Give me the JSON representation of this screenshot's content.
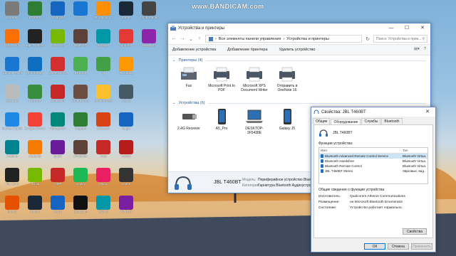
{
  "watermark": "www.BANDICAM.com",
  "desktop_icons": [
    {
      "label": "Корзина",
      "color": "#7a7a7a",
      "col": 0,
      "row": 0
    },
    {
      "label": "µTorrent",
      "color": "#2e7d32",
      "col": 1,
      "row": 0
    },
    {
      "label": "Advanced",
      "color": "#1565c0",
      "col": 2,
      "row": 0
    },
    {
      "label": "PC",
      "color": "#1976d2",
      "col": 3,
      "row": 0
    },
    {
      "label": "FL Studio 20",
      "color": "#ff8f00",
      "col": 4,
      "row": 0
    },
    {
      "label": "Steam",
      "color": "#1b2838",
      "col": 5,
      "row": 0
    },
    {
      "label": "Tomb Raider",
      "color": "#444",
      "col": 6,
      "row": 0
    },
    {
      "label": "Euro Truck",
      "color": "#ff6f00",
      "col": 0,
      "row": 1
    },
    {
      "label": "Epic Games",
      "color": "#222",
      "col": 1,
      "row": 1
    },
    {
      "label": "GeForce",
      "color": "#76b900",
      "col": 2,
      "row": 1
    },
    {
      "label": "Minecraft",
      "color": "#5d4037",
      "col": 3,
      "row": 1
    },
    {
      "label": "Tunngle",
      "color": "#0097a7",
      "col": 4,
      "row": 1
    },
    {
      "label": "Chrome",
      "color": "#e53935",
      "col": 5,
      "row": 1
    },
    {
      "label": "Wallpaper",
      "color": "#8e24aa",
      "col": 6,
      "row": 1
    },
    {
      "label": "Control Panel",
      "color": "#1976d2",
      "col": 0,
      "row": 2
    },
    {
      "label": "TeamViewer",
      "color": "#0e6ebf",
      "col": 1,
      "row": 2
    },
    {
      "label": "Sweet Home",
      "color": "#d32f2f",
      "col": 2,
      "row": 2
    },
    {
      "label": "uTorrent",
      "color": "#4caf50",
      "col": 3,
      "row": 2
    },
    {
      "label": "TI",
      "color": "#43a047",
      "col": 4,
      "row": 2
    },
    {
      "label": "FL Studio",
      "color": "#ff9800",
      "col": 5,
      "row": 2
    },
    {
      "label": "Корзина",
      "color": "#bbb",
      "col": 0,
      "row": 3
    },
    {
      "label": "µTorrent",
      "color": "#388e3c",
      "col": 1,
      "row": 3
    },
    {
      "label": "Bandicam",
      "color": "#c62828",
      "col": 2,
      "row": 3
    },
    {
      "label": "SmartShare",
      "color": "#6d4c41",
      "col": 3,
      "row": 3
    },
    {
      "label": "My Bittorrent",
      "color": "#fbc02d",
      "col": 4,
      "row": 3
    },
    {
      "label": "ASUS",
      "color": "#455a64",
      "col": 5,
      "row": 3
    },
    {
      "label": "Internet Explorer",
      "color": "#1e88e5",
      "col": 0,
      "row": 4
    },
    {
      "label": "Google Chrome",
      "color": "#f44336",
      "col": 1,
      "row": 4
    },
    {
      "label": "Настройки",
      "color": "#00897b",
      "col": 2,
      "row": 4
    },
    {
      "label": "Торрент",
      "color": "#2e7d32",
      "col": 3,
      "row": 4
    },
    {
      "label": "Ccleaner",
      "color": "#d84315",
      "col": 4,
      "row": 4
    },
    {
      "label": "Magic",
      "color": "#1565c0",
      "col": 5,
      "row": 4
    },
    {
      "label": "Arduino",
      "color": "#00838f",
      "col": 0,
      "row": 5
    },
    {
      "label": "Audacity",
      "color": "#f57c00",
      "col": 1,
      "row": 5
    },
    {
      "label": "Quick",
      "color": "#6a1b9a",
      "col": 2,
      "row": 5
    },
    {
      "label": "Simulator",
      "color": "#5d4037",
      "col": 3,
      "row": 5
    },
    {
      "label": "Total",
      "color": "#c62828",
      "col": 4,
      "row": 5
    },
    {
      "label": "Adobe",
      "color": "#b71c1c",
      "col": 5,
      "row": 5
    },
    {
      "label": "The Sims",
      "color": "#222",
      "col": 0,
      "row": 6
    },
    {
      "label": "Nvidia",
      "color": "#76b900",
      "col": 1,
      "row": 6
    },
    {
      "label": "AIMP",
      "color": "#c62828",
      "col": 2,
      "row": 6
    },
    {
      "label": "Spotify",
      "color": "#1db954",
      "col": 3,
      "row": 6
    },
    {
      "label": "Music",
      "color": "#e91e63",
      "col": 4,
      "row": 6
    },
    {
      "label": "Game",
      "color": "#333",
      "col": 5,
      "row": 6
    },
    {
      "label": "Firefox",
      "color": "#e65100",
      "col": 0,
      "row": 7
    },
    {
      "label": "Steam",
      "color": "#1b2838",
      "col": 1,
      "row": 7
    },
    {
      "label": "Word",
      "color": "#1565c0",
      "col": 2,
      "row": 7
    },
    {
      "label": "Bandicam",
      "color": "#111",
      "col": 3,
      "row": 7
    },
    {
      "label": "Switch",
      "color": "#0097a7",
      "col": 4,
      "row": 7
    },
    {
      "label": "WinRAR",
      "color": "#7b1fa2",
      "col": 5,
      "row": 7
    }
  ],
  "explorer": {
    "title": "Устройства и принтеры",
    "min": "—",
    "max": "☐",
    "close": "✕",
    "breadcrumb_1": "Все элементы панели управления",
    "breadcrumb_2": "Устройства и принтеры",
    "search_placeholder": "Поиск: Устройства и прин...",
    "cmd_add_device": "Добавление устройства",
    "cmd_add_printer": "Добавление принтера",
    "cmd_remove": "Удалить устройство",
    "printers_header": "Принтеры (4)",
    "printers": [
      {
        "label": "Fax",
        "kind": "fax"
      },
      {
        "label": "Microsoft Print to PDF",
        "kind": "printer"
      },
      {
        "label": "Microsoft XPS Document Writer",
        "kind": "printer"
      },
      {
        "label": "Отправить в OneNote 16",
        "kind": "printer"
      }
    ],
    "devices_header": "Устройства (6)",
    "devices": [
      {
        "label": "2.4G Receiver",
        "kind": "receiver"
      },
      {
        "label": "A5_Pro",
        "kind": "phone"
      },
      {
        "label": "DESKTOP-3F5438E",
        "kind": "laptop"
      },
      {
        "label": "Galaxy J5",
        "kind": "phone"
      },
      {
        "label": "",
        "kind": "phone"
      }
    ],
    "details": {
      "name": "JBL T460BT",
      "model_key": "Модель:",
      "model_val": "Периферийное устройство Bluetooth",
      "cat_key": "Категория:",
      "cat_val": "Гарнитура Bluetooth Аудиоустройство"
    }
  },
  "dialog": {
    "title": "Свойства: JBL T460BT",
    "close": "✕",
    "tabs": [
      "Общие",
      "Оборудование",
      "Службы",
      "Bluetooth"
    ],
    "active_tab": 1,
    "device_name": "JBL T460BT",
    "functions_label": "Функции устройства:",
    "col_name": "Имя",
    "col_type": "Тип",
    "functions": [
      {
        "name": "Bluetooth Advanced Remote Control Service",
        "type": "Bluetooth Virtua...",
        "selected": true
      },
      {
        "name": "Bluetooth Handsfree",
        "type": "Bluetooth Virtua...",
        "selected": false
      },
      {
        "name": "Bluetooth Remote Control",
        "type": "Bluetooth Virtua...",
        "selected": false
      },
      {
        "name": "JBL T460BT Stereo",
        "type": "Звуковые, вид...",
        "selected": false
      }
    ],
    "summary_label": "Общие сведения о функции устройства",
    "manufacturer_key": "Изготовитель:",
    "manufacturer_val": "Qualcomm Atheros Communications",
    "location_key": "Размещение:",
    "location_val": "на Microsoft Bluetooth Enumerator",
    "status_key": "Состояние:",
    "status_val": "Устройство работает нормально.",
    "properties_button": "Свойства",
    "ok": "ОК",
    "cancel": "Отмена",
    "apply": "Применить"
  }
}
